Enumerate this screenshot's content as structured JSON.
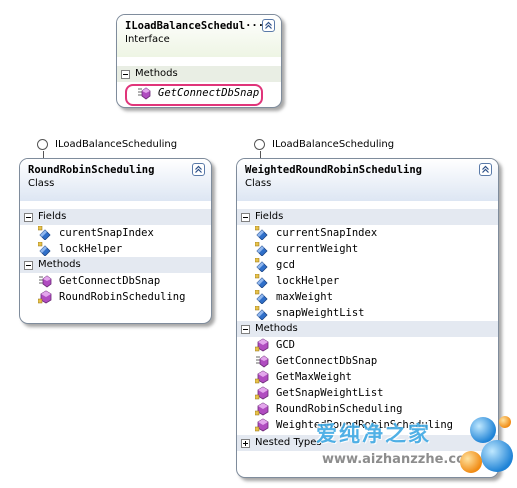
{
  "interface_shape": {
    "title": "ILoadBalanceSchedul···",
    "kind": "Interface",
    "methods_label": "Methods",
    "methods": [
      "GetConnectDbSnap"
    ]
  },
  "lollipops": {
    "left_label": "ILoadBalanceScheduling",
    "right_label": "ILoadBalanceScheduling"
  },
  "round_robin_shape": {
    "title": "RoundRobinScheduling",
    "kind": "Class",
    "fields_label": "Fields",
    "fields": [
      "curentSnapIndex",
      "lockHelper"
    ],
    "methods_label": "Methods",
    "methods": [
      "GetConnectDbSnap",
      "RoundRobinScheduling"
    ]
  },
  "weighted_shape": {
    "title": "WeightedRoundRobinScheduling",
    "kind": "Class",
    "fields_label": "Fields",
    "fields": [
      "currentSnapIndex",
      "currentWeight",
      "gcd",
      "lockHelper",
      "maxWeight",
      "snapWeightList"
    ],
    "methods_label": "Methods",
    "methods": [
      "GCD",
      "GetConnectDbSnap",
      "GetMaxWeight",
      "GetSnapWeightList",
      "RoundRobinScheduling",
      "WeightedRoundRobinScheduling"
    ],
    "nested_label": "Nested Types"
  },
  "watermark": {
    "text": "爱纯净之家",
    "url": "www.aizhanzzhe.com"
  },
  "colors": {
    "highlight": "#e0357a",
    "method_icon": "#b04cc0",
    "field_icon": "#2f6fc9",
    "border": "#7f8c9c"
  }
}
